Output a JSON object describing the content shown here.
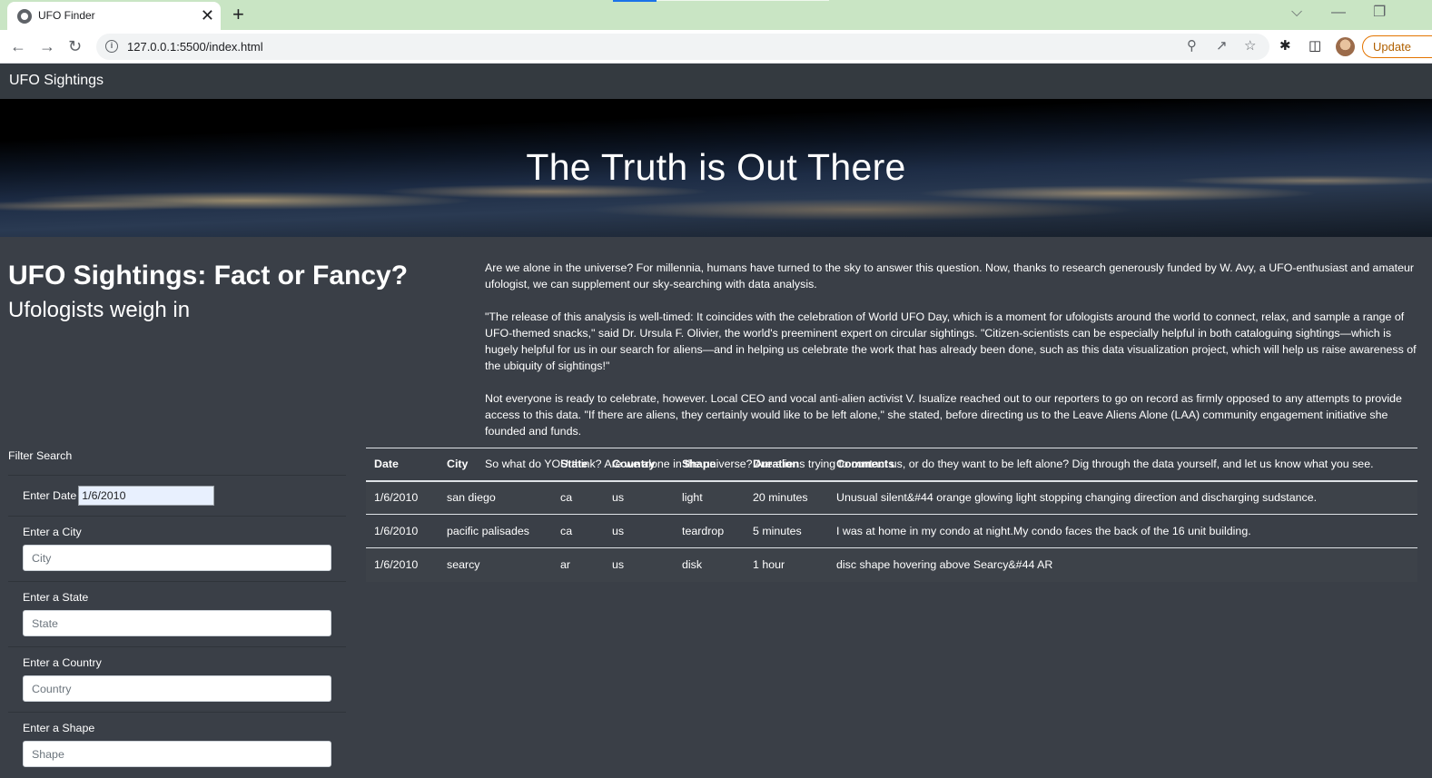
{
  "browser": {
    "tab_title": "UFO Finder",
    "tab_close": "✕",
    "new_tab": "+",
    "url": "127.0.0.1:5500/index.html",
    "update_label": "Update",
    "window_controls": {
      "dropdown": "⌵",
      "minimize": "—",
      "restore": "❐"
    }
  },
  "navbar": {
    "brand": "UFO Sightings"
  },
  "hero": {
    "title": "The Truth is Out There"
  },
  "heading": {
    "title": "UFO Sightings: Fact or Fancy?",
    "subtitle": "Ufologists weigh in"
  },
  "article": {
    "paragraphs": [
      "Are we alone in the universe? For millennia, humans have turned to the sky to answer this question. Now, thanks to research generously funded by W. Avy, a UFO-enthusiast and amateur ufologist, we can supplement our sky-searching with data analysis.",
      "\"The release of this analysis is well-timed: It coincides with the celebration of World UFO Day, which is a moment for ufologists around the world to connect, relax, and sample a range of UFO-themed snacks,\" said Dr. Ursula F. Olivier, the world's preeminent expert on circular sightings. \"Citizen-scientists can be especially helpful in both cataloguing sightings—which is hugely helpful for us in our search for aliens—and in helping us celebrate the work that has already been done, such as this data visualization project, which will help us raise awareness of the ubiquity of sightings!\"",
      "Not everyone is ready to celebrate, however. Local CEO and vocal anti-alien activist V. Isualize reached out to our reporters to go on record as firmly opposed to any attempts to provide access to this data. \"If there are aliens, they certainly would like to be left alone,\" she stated, before directing us to the Leave Aliens Alone (LAA) community engagement initiative she founded and funds.",
      "So what do YOU think? Are we alone in the universe? Are aliens trying to contact us, or do they want to be left alone? Dig through the data yourself, and let us know what you see."
    ]
  },
  "filters": {
    "title": "Filter Search",
    "date": {
      "label": "Enter Date",
      "value": "1/6/2010"
    },
    "city": {
      "label": "Enter a City",
      "placeholder": "City"
    },
    "state": {
      "label": "Enter a State",
      "placeholder": "State"
    },
    "country": {
      "label": "Enter a Country",
      "placeholder": "Country"
    },
    "shape": {
      "label": "Enter a Shape",
      "placeholder": "Shape"
    }
  },
  "table": {
    "headers": [
      "Date",
      "City",
      "State",
      "Country",
      "Shape",
      "Duration",
      "Comments"
    ],
    "rows": [
      [
        "1/6/2010",
        "san diego",
        "ca",
        "us",
        "light",
        "20 minutes",
        "Unusual silent&#44 orange glowing light stopping changing direction and discharging sudstance."
      ],
      [
        "1/6/2010",
        "pacific palisades",
        "ca",
        "us",
        "teardrop",
        "5 minutes",
        "I was at home in my condo at night.My condo faces the back of the 16 unit building."
      ],
      [
        "1/6/2010",
        "searcy",
        "ar",
        "us",
        "disk",
        "1 hour",
        "disc shape hovering above Searcy&#44 AR"
      ]
    ]
  }
}
